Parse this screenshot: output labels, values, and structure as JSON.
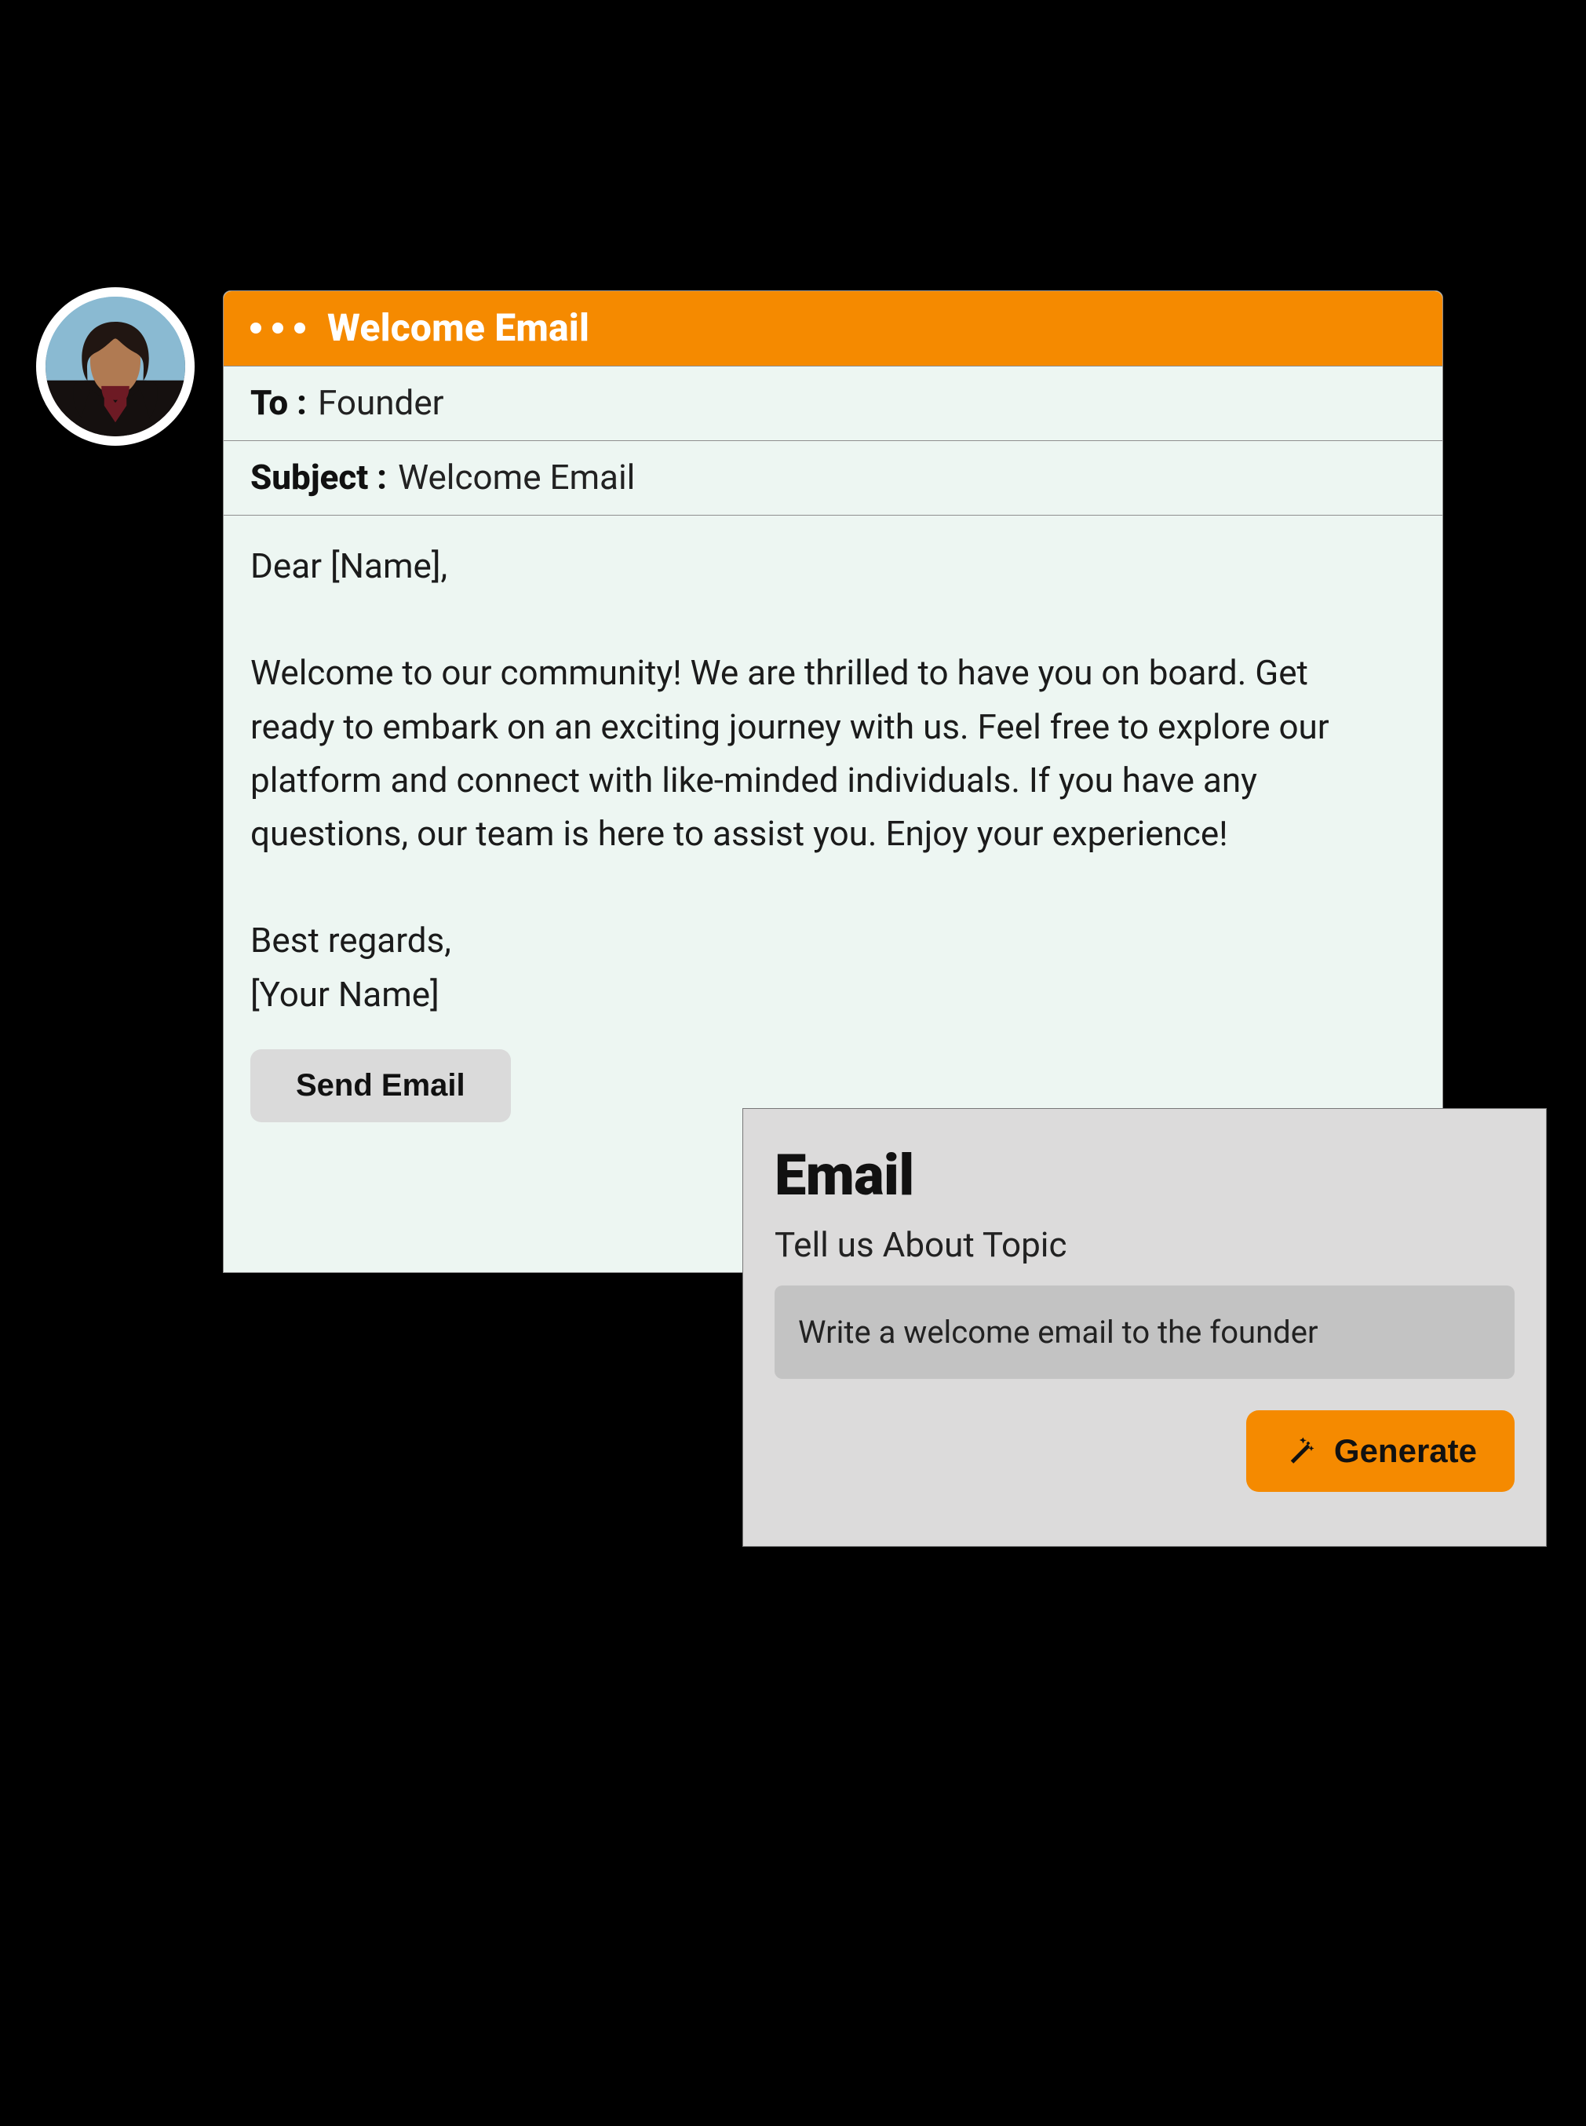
{
  "avatar": {
    "alt": "user-avatar"
  },
  "email": {
    "header_title": "Welcome Email",
    "to_label": "To :",
    "to_value": "Founder",
    "subject_label": "Subject :",
    "subject_value": "Welcome Email",
    "body": "Dear [Name],\n\nWelcome to our community! We are thrilled to have you on board. Get ready to embark on an exciting journey with us. Feel free to explore our platform and connect with like-minded individuals. If you have any questions, our team is here to assist you. Enjoy your experience!\n\nBest regards,\n[Your Name]",
    "send_label": "Send Email"
  },
  "prompt": {
    "heading": "Email",
    "sub": "Tell us About Topic",
    "input_value": "Write a welcome email to the founder",
    "generate_label": "Generate"
  },
  "colors": {
    "accent": "#f58a00",
    "panel": "#dcdbdb",
    "card": "#edf6f2"
  }
}
